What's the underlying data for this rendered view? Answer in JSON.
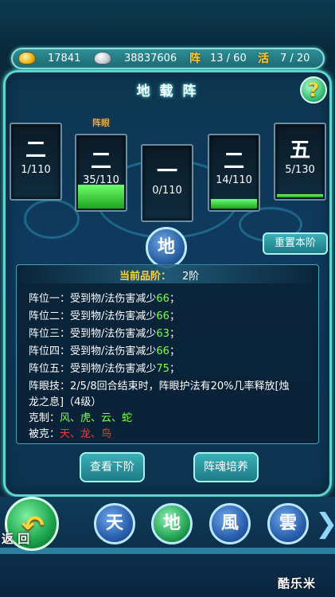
{
  "resources": {
    "gold": "17841",
    "silver": "38837606",
    "formation_glyph": "阵",
    "formation_count": "13 / 60",
    "active_glyph": "活",
    "active_count": "7 / 20"
  },
  "panel": {
    "title": "地 载 阵",
    "help": "?",
    "eye_label": "阵眼"
  },
  "slots": [
    {
      "glyph": "二",
      "count": "1/110",
      "fill": 0
    },
    {
      "glyph": "二",
      "count": "35/110",
      "fill": 0.32
    },
    {
      "glyph": "一",
      "count": "0/110",
      "fill": 0
    },
    {
      "glyph": "二",
      "count": "14/110",
      "fill": 0.13
    },
    {
      "glyph": "五",
      "count": "5/130",
      "fill": 0.04
    }
  ],
  "center_glyph": "地",
  "reset_button": "重置本阶",
  "grade": {
    "label": "当前品阶：",
    "value": "2阶"
  },
  "positions": [
    {
      "label": "阵位一：",
      "text": "受到物/法伤害减少",
      "value": "66",
      "suffix": "；"
    },
    {
      "label": "阵位二：",
      "text": "受到物/法伤害减少",
      "value": "66",
      "suffix": "；"
    },
    {
      "label": "阵位三：",
      "text": "受到物/法伤害减少",
      "value": "63",
      "suffix": "；"
    },
    {
      "label": "阵位四：",
      "text": "受到物/法伤害减少",
      "value": "66",
      "suffix": "；"
    },
    {
      "label": "阵位五：",
      "text": "受到物/法伤害减少",
      "value": "75",
      "suffix": "；"
    }
  ],
  "eye_skill": {
    "label": "阵眼技：",
    "line1": "2/5/8回合结束时，阵眼护法有20%几率释放[烛",
    "line2": "龙之息]（4级）"
  },
  "counters": {
    "label": "克制：",
    "value": "风、虎、云、蛇"
  },
  "countered_by": {
    "label": "被克：",
    "value": "天、龙、鸟"
  },
  "buttons": {
    "next_tier": "查看下阶",
    "soul_train": "阵魂培养"
  },
  "back": {
    "label": "返 回",
    "arrow": "↶"
  },
  "formations": [
    "天",
    "地",
    "風",
    "雲"
  ],
  "next_arrow": "❯",
  "watermark": "酷乐米"
}
